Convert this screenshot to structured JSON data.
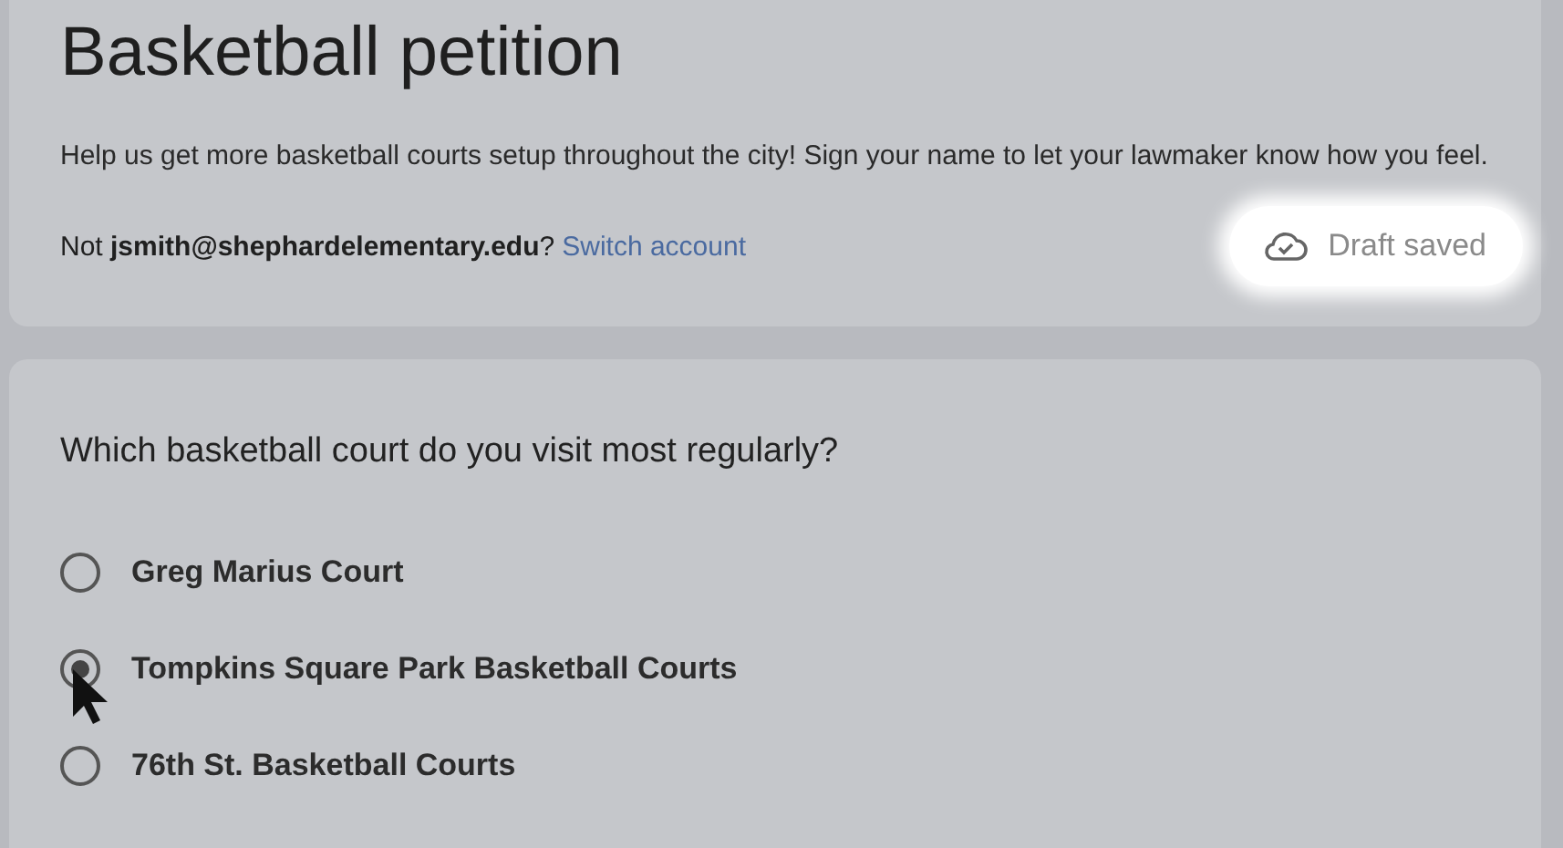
{
  "header": {
    "title": "Basketball petition",
    "description": "Help us get more basketball courts setup throughout the city! Sign your name to let your lawmaker know how you feel.",
    "account_prefix": "Not ",
    "account_email": "jsmith@shephardelementary.edu",
    "account_suffix": "?",
    "switch_link": "Switch account",
    "draft_status": "Draft saved"
  },
  "question": {
    "title": "Which basketball court do you visit most regularly?",
    "options": [
      {
        "label": "Greg Marius Court",
        "selected": false
      },
      {
        "label": "Tompkins Square Park Basketball Courts",
        "selected": true
      },
      {
        "label": "76th St. Basketball Courts",
        "selected": false
      }
    ]
  }
}
